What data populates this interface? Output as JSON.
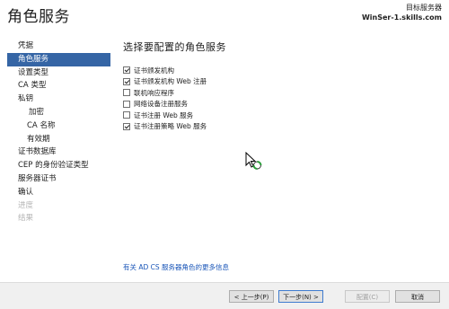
{
  "header": {
    "title": "角色服务",
    "target_label": "目标服务器",
    "target_server": "WinSer-1.skills.com"
  },
  "sidebar": {
    "items": [
      {
        "label": "凭据",
        "state": "normal"
      },
      {
        "label": "角色服务",
        "state": "active"
      },
      {
        "label": "设置类型",
        "state": "normal"
      },
      {
        "label": "CA 类型",
        "state": "normal"
      },
      {
        "label": "私钥",
        "state": "normal"
      },
      {
        "label": "加密",
        "state": "sub"
      },
      {
        "label": "CA 名称",
        "state": "sub"
      },
      {
        "label": "有效期",
        "state": "sub"
      },
      {
        "label": "证书数据库",
        "state": "normal"
      },
      {
        "label": "CEP 的身份验证类型",
        "state": "normal"
      },
      {
        "label": "服务器证书",
        "state": "normal"
      },
      {
        "label": "确认",
        "state": "normal"
      },
      {
        "label": "进度",
        "state": "disabled"
      },
      {
        "label": "结果",
        "state": "disabled"
      }
    ]
  },
  "main": {
    "section_title": "选择要配置的角色服务",
    "roles": [
      {
        "label": "证书颁发机构",
        "checked": true
      },
      {
        "label": "证书颁发机构 Web 注册",
        "checked": true
      },
      {
        "label": "联机响应程序",
        "checked": false
      },
      {
        "label": "网络设备注册服务",
        "checked": false
      },
      {
        "label": "证书注册 Web 服务",
        "checked": false
      },
      {
        "label": "证书注册策略 Web 服务",
        "checked": true
      }
    ],
    "more_info_link": "有关 AD CS 服务器角色的更多信息"
  },
  "footer": {
    "prev_label": "< 上一步(P)",
    "next_label": "下一步(N) >",
    "configure_label": "配置(C)",
    "cancel_label": "取消"
  },
  "colors": {
    "active_nav": "#3565a5",
    "link": "#1a56b8",
    "footer_bg": "#f0f0f0"
  }
}
